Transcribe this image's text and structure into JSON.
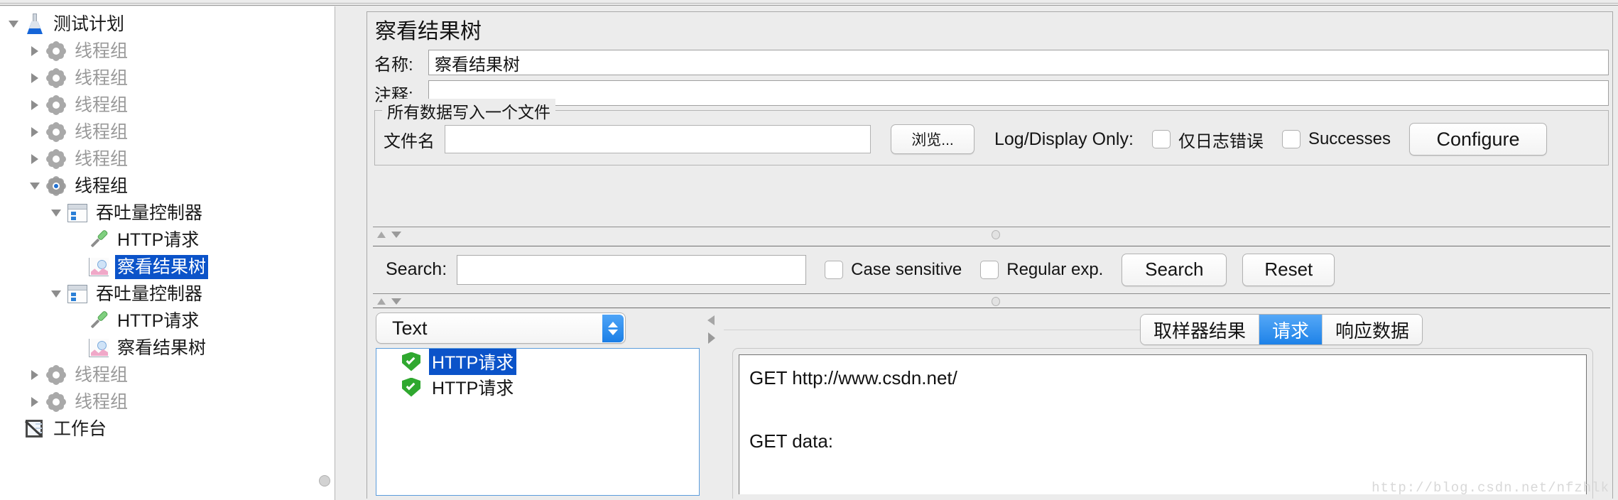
{
  "tree": {
    "items": [
      {
        "label": "测试计划",
        "icon": "flask-icon",
        "indent": 0,
        "expander": "down",
        "state": "normal",
        "selected": false
      },
      {
        "label": "线程组",
        "icon": "gear-icon",
        "indent": 1,
        "expander": "right",
        "state": "disabled",
        "selected": false
      },
      {
        "label": "线程组",
        "icon": "gear-icon",
        "indent": 1,
        "expander": "right",
        "state": "disabled",
        "selected": false
      },
      {
        "label": "线程组",
        "icon": "gear-icon",
        "indent": 1,
        "expander": "right",
        "state": "disabled",
        "selected": false
      },
      {
        "label": "线程组",
        "icon": "gear-icon",
        "indent": 1,
        "expander": "right",
        "state": "disabled",
        "selected": false
      },
      {
        "label": "线程组",
        "icon": "gear-icon",
        "indent": 1,
        "expander": "right",
        "state": "disabled",
        "selected": false
      },
      {
        "label": "线程组",
        "icon": "gear-active-icon",
        "indent": 1,
        "expander": "down",
        "state": "normal",
        "selected": false
      },
      {
        "label": "吞吐量控制器",
        "icon": "controller-icon",
        "indent": 2,
        "expander": "down",
        "state": "normal",
        "selected": false
      },
      {
        "label": "HTTP请求",
        "icon": "pipette-icon",
        "indent": 3,
        "expander": "none",
        "state": "normal",
        "selected": false
      },
      {
        "label": "察看结果树",
        "icon": "results-tree-icon",
        "indent": 3,
        "expander": "none",
        "state": "normal",
        "selected": true
      },
      {
        "label": "吞吐量控制器",
        "icon": "controller-icon",
        "indent": 2,
        "expander": "down",
        "state": "normal",
        "selected": false
      },
      {
        "label": "HTTP请求",
        "icon": "pipette-icon",
        "indent": 3,
        "expander": "none",
        "state": "normal",
        "selected": false
      },
      {
        "label": "察看结果树",
        "icon": "results-tree-icon",
        "indent": 3,
        "expander": "none",
        "state": "normal",
        "selected": false
      },
      {
        "label": "线程组",
        "icon": "gear-icon",
        "indent": 1,
        "expander": "right",
        "state": "disabled",
        "selected": false
      },
      {
        "label": "线程组",
        "icon": "gear-icon",
        "indent": 1,
        "expander": "right",
        "state": "disabled",
        "selected": false
      },
      {
        "label": "工作台",
        "icon": "workbench-icon",
        "indent": 0,
        "expander": "none",
        "state": "normal",
        "selected": false
      }
    ]
  },
  "panel": {
    "title": "察看结果树",
    "name_label": "名称:",
    "name_value": "察看结果树",
    "comment_label": "注释:",
    "comment_value": ""
  },
  "file_group": {
    "legend": "所有数据写入一个文件",
    "filename_label": "文件名",
    "filename_value": "",
    "browse_label": "浏览...",
    "log_display_label": "Log/Display Only:",
    "errors_only_label": "仅日志错误",
    "errors_only_checked": false,
    "successes_label": "Successes",
    "successes_checked": false,
    "configure_label": "Configure"
  },
  "search": {
    "label": "Search:",
    "value": "",
    "case_sensitive_label": "Case sensitive",
    "case_sensitive_checked": false,
    "regex_label": "Regular exp.",
    "regex_checked": false,
    "search_button": "Search",
    "reset_button": "Reset"
  },
  "results": {
    "renderer_selected": "Text",
    "items": [
      {
        "label": "HTTP请求",
        "status": "success",
        "selected": true
      },
      {
        "label": "HTTP请求",
        "status": "success",
        "selected": false
      }
    ]
  },
  "tabs": [
    {
      "label": "取样器结果",
      "active": false
    },
    {
      "label": "请求",
      "active": true
    },
    {
      "label": "响应数据",
      "active": false
    }
  ],
  "request_content": "GET http://www.csdn.net/\n\nGET data:\n\n\n[no cookies]",
  "watermark": "http://blog.csdn.net/nfzhlk",
  "colors": {
    "selection_blue": "#0b53c9",
    "tab_active_blue": "#1e82e8",
    "panel_bg": "#ececec",
    "success_green": "#2fa82f"
  }
}
